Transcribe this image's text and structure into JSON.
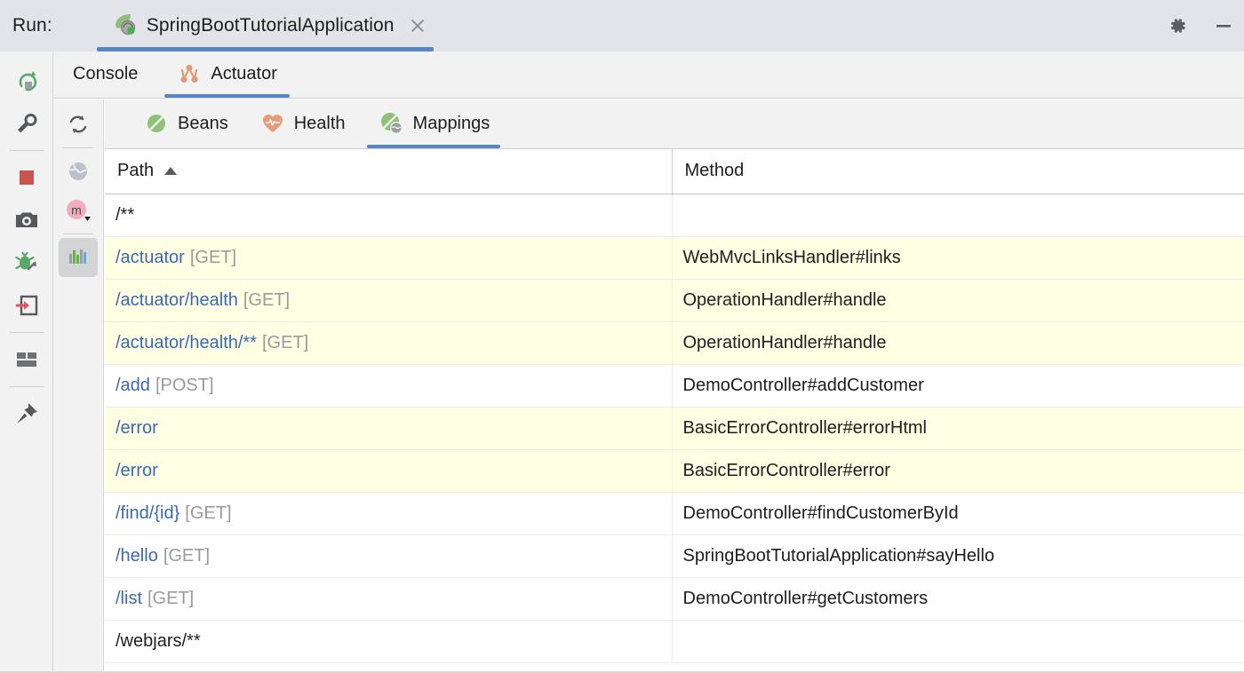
{
  "window": {
    "run_label": "Run:",
    "run_config_name": "SpringBootTutorialApplication",
    "close_tab_title": "Close",
    "settings_title": "Settings",
    "minimize_title": "Hide"
  },
  "tabs": [
    {
      "label": "Console",
      "icon": "none",
      "active": false
    },
    {
      "label": "Actuator",
      "icon": "actuator-graph-icon",
      "active": true
    }
  ],
  "sub_toolbar": [
    {
      "name": "refresh-icon",
      "label": "Refresh"
    },
    {
      "name": "globe-icon",
      "label": "Open in Browser"
    },
    {
      "name": "maven-icon",
      "label": "m"
    },
    {
      "name": "endpoints-chart-icon",
      "label": "Endpoints",
      "selected": true
    }
  ],
  "left_toolbar": [
    {
      "name": "rerun-icon",
      "label": "Rerun"
    },
    {
      "name": "wrench-icon",
      "label": "Edit Configuration"
    },
    {
      "name": "stop-icon",
      "label": "Stop"
    },
    {
      "name": "camera-icon",
      "label": "Capture Memory Snapshot"
    },
    {
      "name": "debug-attach-icon",
      "label": "Attach Debugger"
    },
    {
      "name": "exit-icon",
      "label": "Exit"
    },
    {
      "name": "layout-icon",
      "label": "Layout Settings"
    },
    {
      "name": "pin-icon",
      "label": "Pin Tab"
    }
  ],
  "endpoint_tabs": [
    {
      "label": "Beans",
      "icon": "bean-icon",
      "active": false
    },
    {
      "label": "Health",
      "icon": "heart-icon",
      "active": false
    },
    {
      "label": "Mappings",
      "icon": "bean-globe-icon",
      "active": true
    }
  ],
  "table": {
    "columns": [
      {
        "key": "path",
        "label": "Path",
        "sorted": true,
        "sort_dir": "asc"
      },
      {
        "key": "method",
        "label": "Method",
        "sorted": false
      }
    ],
    "rows": [
      {
        "path": "/**",
        "verb": "",
        "method": "",
        "highlight": false,
        "link": false
      },
      {
        "path": "/actuator",
        "verb": "[GET]",
        "method": "WebMvcLinksHandler#links",
        "highlight": true,
        "link": true
      },
      {
        "path": "/actuator/health",
        "verb": "[GET]",
        "method": "OperationHandler#handle",
        "highlight": true,
        "link": true
      },
      {
        "path": "/actuator/health/**",
        "verb": "[GET]",
        "method": "OperationHandler#handle",
        "highlight": true,
        "link": true
      },
      {
        "path": "/add",
        "verb": "[POST]",
        "method": "DemoController#addCustomer",
        "highlight": false,
        "link": true
      },
      {
        "path": "/error",
        "verb": "",
        "method": "BasicErrorController#errorHtml",
        "highlight": true,
        "link": true
      },
      {
        "path": "/error",
        "verb": "",
        "method": "BasicErrorController#error",
        "highlight": true,
        "link": true
      },
      {
        "path": "/find/{id}",
        "verb": "[GET]",
        "method": "DemoController#findCustomerById",
        "highlight": false,
        "link": true
      },
      {
        "path": "/hello",
        "verb": "[GET]",
        "method": "SpringBootTutorialApplication#sayHello",
        "highlight": false,
        "link": true
      },
      {
        "path": "/list",
        "verb": "[GET]",
        "method": "DemoController#getCustomers",
        "highlight": false,
        "link": true
      },
      {
        "path": "/webjars/**",
        "verb": "",
        "method": "",
        "highlight": false,
        "link": false
      }
    ]
  },
  "colors": {
    "header_bg": "#e2e4e9",
    "toolbar_bg": "#f2f2f2",
    "accent_blue": "#5786c7",
    "link_blue": "#3a69b0",
    "row_highlight": "#ffffe4",
    "bean_green": "#7fbd72",
    "health_salmon": "#e69977",
    "maven_pink": "#f0afbd",
    "stop_red": "#c75450"
  }
}
